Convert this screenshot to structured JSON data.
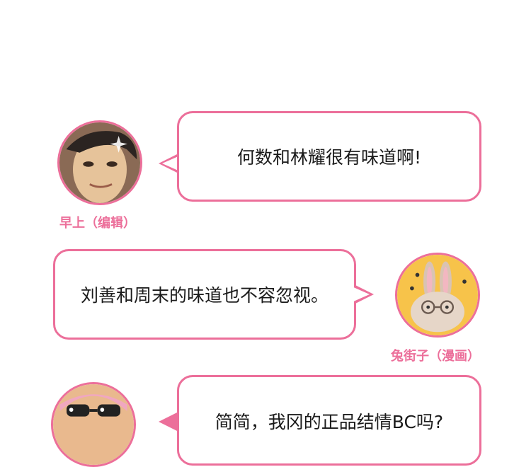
{
  "accent_color": "#ec6f9a",
  "messages": [
    {
      "speaker": "早上（编辑）",
      "text": "何数和林耀很有味道啊!"
    },
    {
      "speaker": "兔街子（漫画）",
      "text": "刘善和周末的味道也不容忽视。"
    },
    {
      "speaker": "",
      "text": "简简，我冈的正品结情BC吗?"
    }
  ]
}
